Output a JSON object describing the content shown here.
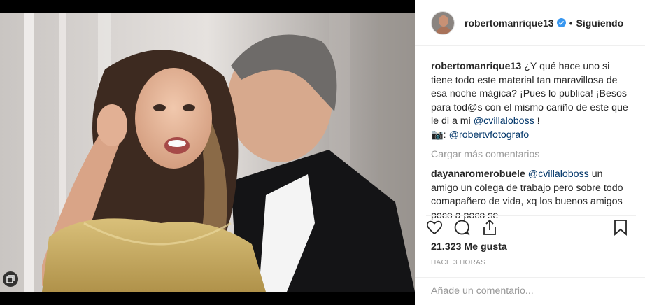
{
  "post": {
    "username": "robertomanrique13",
    "follow_status": "Siguiendo",
    "dot": "•",
    "caption_text": "¿Y qué hace uno si tiene todo este material tan maravillosa de esa noche mágica? ¡Pues lo publica! ¡Besos para tod@s con el mismo cariño de este que le di a mi",
    "caption_mention": "@cvillaloboss",
    "caption_end": " !",
    "credit_emoji": "📷",
    "credit_prefix": ": ",
    "credit_mention": "@robertvfotografo",
    "load_more": "Cargar más comentarios",
    "comments": [
      {
        "user": "dayanaromerobuele",
        "mention": "@cvillaloboss",
        "text": " un amigo un colega de trabajo pero sobre todo comapañero de vida, xq los buenos amigos poco a poco se"
      }
    ],
    "likes": "21.323 Me gusta",
    "time": "HACE 3 HORAS",
    "add_comment_placeholder": "Añade un comentario..."
  },
  "icons": {
    "like": "heart-icon",
    "comment": "comment-bubble-icon",
    "share": "share-icon",
    "save": "bookmark-icon",
    "verified": "verified-badge-icon",
    "gallery": "gallery-icon"
  },
  "colors": {
    "verified_blue": "#3897f0",
    "mention": "#003569",
    "muted": "#999999",
    "text": "#262626"
  }
}
